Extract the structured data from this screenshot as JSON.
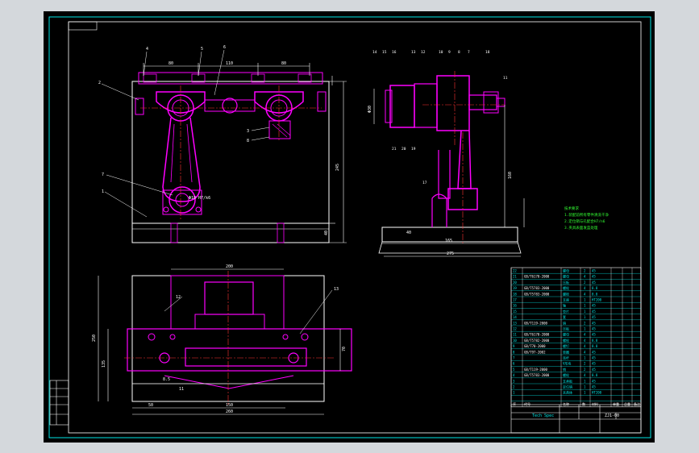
{
  "drawing_no": "ZJ1-00",
  "title_text": "Tech Spec",
  "notes_title": "技术要求",
  "notes_lines": [
    "1.装配前所有零件清洗干净",
    "2.定位销与孔配合H7/n6",
    "3.夹具表面发蓝处理"
  ],
  "top_view": {
    "dims": [
      "80",
      "110",
      "80"
    ],
    "height_dim": "245",
    "base_dim": "40",
    "balloons": [
      "4",
      "5",
      "6",
      "2",
      "3",
      "8",
      "7",
      "1"
    ],
    "hole_note": "Φ18 H7/k6"
  },
  "side_view": {
    "balloons": [
      "14",
      "15",
      "16",
      "13",
      "12",
      "10",
      "9",
      "8",
      "7",
      "18",
      "11",
      "21",
      "20",
      "19",
      "17"
    ],
    "dims": [
      "Φ30",
      "165",
      "40",
      "185",
      "275"
    ],
    "height_dim": "160"
  },
  "plan_view": {
    "dims": [
      "200",
      "250",
      "135",
      "50",
      "150",
      "260",
      "70"
    ],
    "balloons": [
      "12",
      "13",
      "11",
      "8.5"
    ]
  },
  "parts_list": {
    "header": [
      "序号",
      "代号",
      "名称",
      "数量",
      "材料"
    ],
    "rows": [
      [
        "22",
        "",
        "螺母",
        "2",
        "45"
      ],
      [
        "21",
        "GB/T6170-2000",
        "螺母",
        "4",
        "45"
      ],
      [
        "20",
        "",
        "压板",
        "2",
        "45"
      ],
      [
        "19",
        "GB/T5783-2000",
        "螺栓",
        "4",
        "8.8"
      ],
      [
        "18",
        "GB/T5783-2000",
        "螺栓",
        "4",
        "8.8"
      ],
      [
        "17",
        "",
        "支座",
        "1",
        "HT200"
      ],
      [
        "16",
        "",
        "轴",
        "1",
        "45"
      ],
      [
        "15",
        "",
        "垫片",
        "1",
        "45"
      ],
      [
        "14",
        "",
        "套",
        "1",
        "45"
      ],
      [
        "13",
        "GB/T119-2000",
        "销",
        "2",
        "45"
      ],
      [
        "12",
        "",
        "压板",
        "1",
        "45"
      ],
      [
        "11",
        "GB/T6170-2000",
        "螺母",
        "4",
        "45"
      ],
      [
        "10",
        "GB/T5782-2000",
        "螺栓",
        "4",
        "8.8"
      ],
      [
        "9",
        "GB/T70-2000",
        "螺钉",
        "4",
        "8.8"
      ],
      [
        "8",
        "GB/T97-2002",
        "垫圈",
        "4",
        "45"
      ],
      [
        "7",
        "",
        "连杆",
        "1",
        "45"
      ],
      [
        "6",
        "",
        "V形块",
        "2",
        "45"
      ],
      [
        "5",
        "GB/T119-2000",
        "销",
        "2",
        "45"
      ],
      [
        "4",
        "GB/T5783-2000",
        "螺栓",
        "4",
        "8.8"
      ],
      [
        "3",
        "",
        "支承板",
        "1",
        "45"
      ],
      [
        "2",
        "",
        "定位销",
        "1",
        "45"
      ],
      [
        "1",
        "",
        "夹具体",
        "1",
        "HT200"
      ]
    ],
    "footer_cols": [
      "序",
      "代号",
      "名称",
      "数",
      "材料",
      "单重",
      "总重",
      "备注"
    ]
  },
  "colors": {
    "frame": "#00e5e5",
    "part": "#ff00ff",
    "dim": "#ffffff",
    "note": "#33ff33",
    "balloon": "#00e5e5"
  }
}
